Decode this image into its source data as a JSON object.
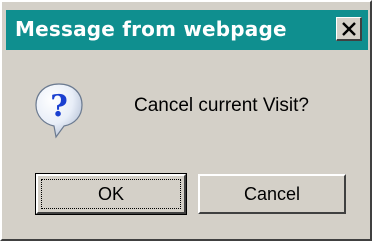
{
  "window": {
    "title": "Message from webpage",
    "close_symbol": "✕"
  },
  "message": {
    "icon": "question-bubble-icon",
    "text": "Cancel current Visit?"
  },
  "buttons": {
    "ok_label": "OK",
    "cancel_label": "Cancel"
  },
  "colors": {
    "titlebar": "#0f8f8f",
    "face": "#d4d0c8",
    "icon_blue": "#1a3fd0"
  }
}
